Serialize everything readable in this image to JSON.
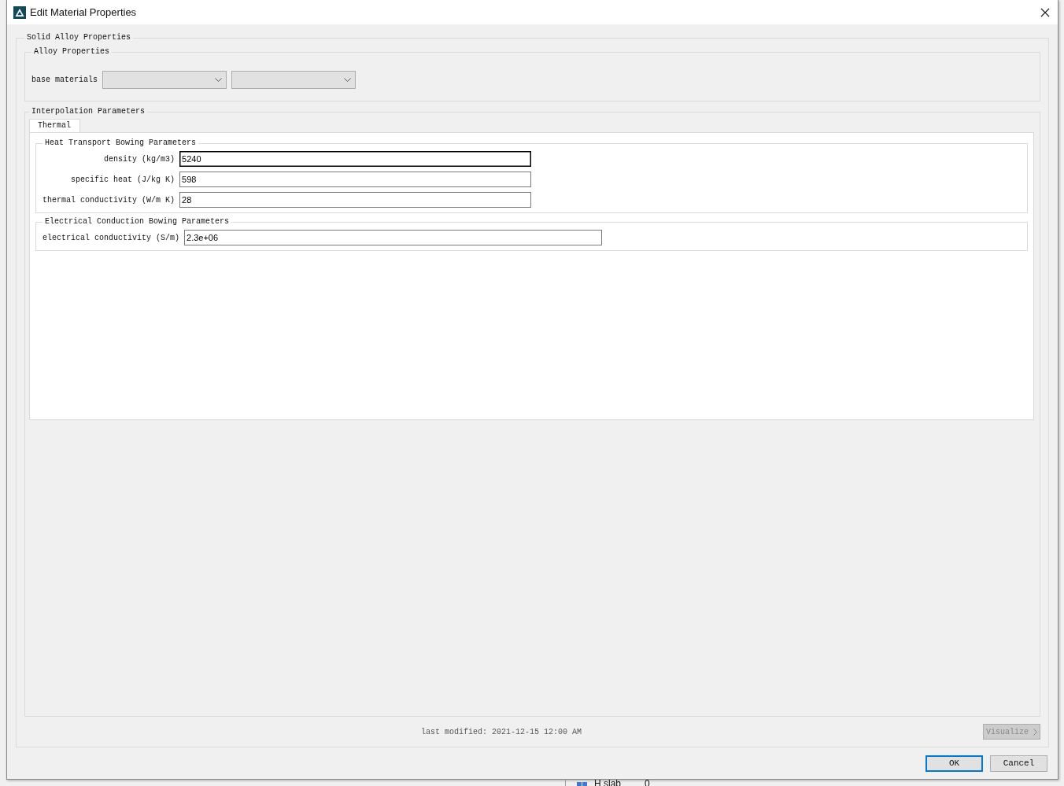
{
  "window": {
    "title": "Edit Material Properties"
  },
  "solid_alloy_properties": {
    "title": "Solid Alloy Properties",
    "alloy_properties": {
      "title": "Alloy Properties",
      "label": "base materials",
      "dropdowns": [
        {
          "disabled": true
        },
        {
          "disabled": true
        }
      ]
    },
    "interpolation_parameters": {
      "title": "Interpolation Parameters",
      "tabs": [
        {
          "label": "Thermal",
          "selected": true
        }
      ],
      "sections": [
        {
          "title": "Heat Transport Bowing Parameters",
          "fields": [
            {
              "label": "density (kg/m3)",
              "value": "5240",
              "focused": true
            },
            {
              "label": "specific heat (J/kg K)",
              "value": "598",
              "focused": false
            },
            {
              "label": "thermal conductivity (W/m K)",
              "value": "28",
              "focused": false
            }
          ]
        },
        {
          "title": "Electrical Conduction Bowing Parameters",
          "fields": [
            {
              "label": "electrical conductivity (S/m)",
              "value": "2.3e+06",
              "focused": false
            }
          ]
        }
      ]
    },
    "last_modified": "last modified: 2021-12-15 12:00 AM",
    "visualize_button": {
      "label": "Visualize",
      "disabled": true
    }
  },
  "buttons": [
    {
      "label": "OK",
      "default": true
    },
    {
      "label": "Cancel",
      "default": false
    }
  ],
  "background_row": {
    "label": "H slab",
    "value": "0"
  }
}
